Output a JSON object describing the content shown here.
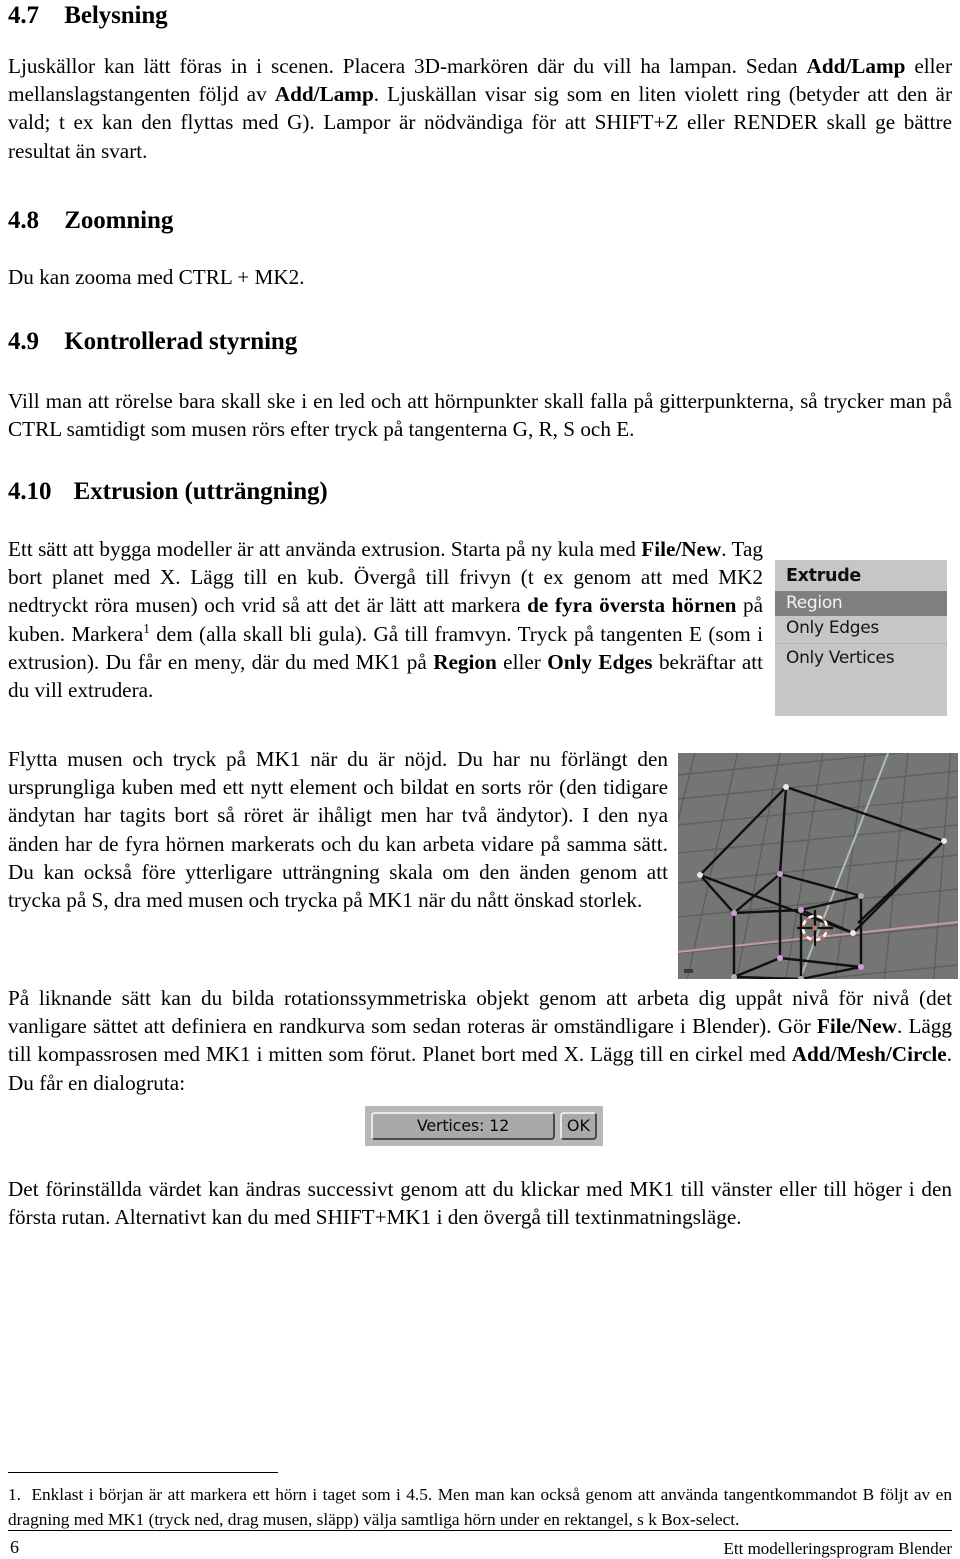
{
  "document": {
    "language": "sv",
    "page_number": "6",
    "footer_title": "Ett modelleringsprogram Blender"
  },
  "sections": [
    {
      "number": "4.7",
      "title": "Belysning",
      "paragraph_html": "Ljuskällor kan lätt föras in i scenen. Placera 3D-markören där du vill ha lampan. Sedan <b>Add/Lamp</b> eller mellanslagstangenten följd av <b>Add/Lamp</b>. Ljuskällan visar sig som en liten violett ring (betyder att den är vald; t ex kan den flyttas med G). Lampor är nödvändiga för att SHIFT+Z eller RENDER skall ge bättre resultat än svart."
    },
    {
      "number": "4.8",
      "title": "Zoomning",
      "paragraph_html": "Du kan zooma med CTRL + MK2."
    },
    {
      "number": "4.9",
      "title": "Kontrollerad styrning",
      "paragraph_html": "Vill man att rörelse bara skall ske i en led och att hörnpunkter skall falla på gitterpunkterna, så trycker man på CTRL samtidigt som musen rörs efter tryck på tangenterna G, R, S och E."
    },
    {
      "number": "4.10",
      "title": "Extrusion (utträngning)",
      "paragraph_html": "Ett sätt att bygga modeller är att använda extrusion. Starta på ny kula med <b>File/New</b>. Tag bort planet med X. Lägg till en kub. Övergå till frivyn (t ex genom att med MK2 nedtryckt röra musen) och vrid så att det är lätt att markera <b>de fyra översta hörnen</b> på kuben. Markera<sup>1</sup> dem (alla skall bli gula). Gå till framvyn. Tryck på tangenten E (som i extrusion). Du får en meny, där du med MK1 på <b>Region</b> eller <b>Only Edges</b> bekräftar att du vill extrudera."
    }
  ],
  "paragraphs": {
    "after_extrude_menu": "Flytta musen och tryck på MK1 när du är nöjd. Du har nu förlängt den ursprungliga kuben med ett nytt element och bildat en sorts rör (den tidigare ändytan har tagits bort så röret är ihåligt men har två ändytor). I den nya änden har de fyra hörnen markerats och du kan arbeta vidare på samma sätt. Du kan också före ytterligare utträngning skala om den änden genom att trycka på S, dra med musen och trycka på MK1 när du nått önskad storlek.",
    "rotation_symmetric_html": "På liknande sätt kan du bilda rotationssymmetriska objekt genom att arbeta dig uppåt nivå för nivå (det vanligare sättet att definiera en randkurva som sedan roteras är omständligare i Blender). Gör <b>File/New</b>. Lägg till kompassrosen med MK1 i mitten som förut. Planet bort med X. Lägg till en cirkel med <b>Add/Mesh/Circle</b>. Du får en dialogruta:",
    "after_dialog": "Det förinställda värdet kan ändras successivt genom att du klickar med MK1 till vänster eller till höger i den första rutan. Alternativt kan du med SHIFT+MK1 i den övergå till textinmatningsläge."
  },
  "footnote": {
    "marker": "1.",
    "text": "Enklast i början är att markera ett hörn i taget som i 4.5. Men man kan också genom att använda tangentkommandot B följt av en dragning med MK1 (tryck ned, drag musen, släpp) välja samtliga hörn under en rektangel, s k Box-select."
  },
  "figures": {
    "extrude_menu": {
      "title": "Extrude",
      "items": [
        {
          "label": "Region",
          "selected": true
        },
        {
          "label": "Only Edges",
          "selected": false
        },
        {
          "label": "Only Vertices",
          "selected": false
        }
      ],
      "colors": {
        "background": "#c6c6c6",
        "highlight": "#808080",
        "highlight_text": "#f2f2f2",
        "text": "#141414"
      }
    },
    "viewport": {
      "description": "Blender 3D wireframe viewport showing an extruded cube",
      "colors": {
        "background": "#757575",
        "grid": "#5e5e5e",
        "x_axis": "#c79a9a",
        "y_axis": "#a8c1a8",
        "wire": "#101010",
        "selected_vertex": "#c9a0d0",
        "unselected_vertex": "#e8e8e8",
        "cursor": "#d06a5a"
      }
    },
    "vertices_dialog": {
      "field_label": "Vertices: 12",
      "ok_label": "OK",
      "colors": {
        "panel": "#b8b8b8",
        "button": "#a9a9a9"
      }
    }
  }
}
